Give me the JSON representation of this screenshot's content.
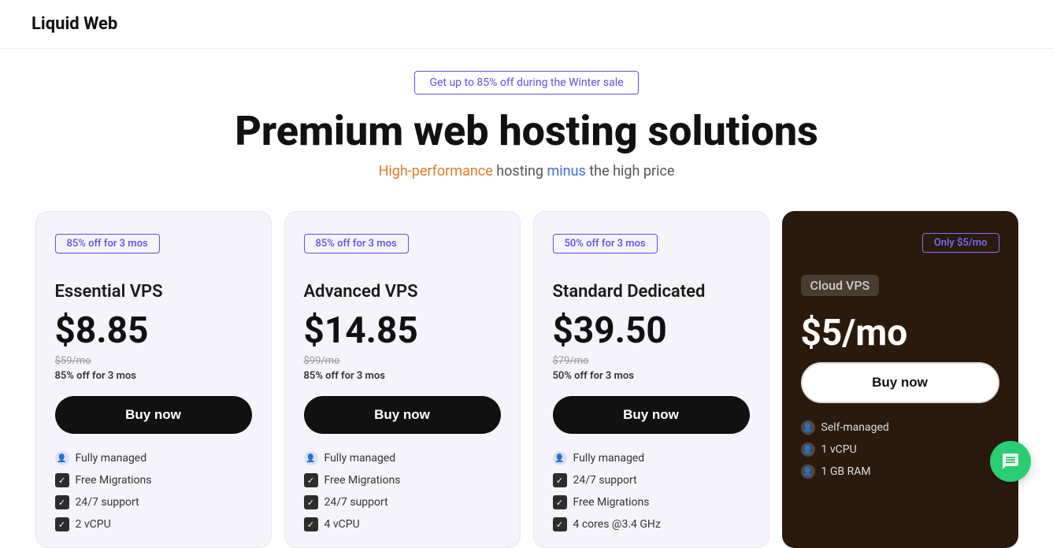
{
  "header": {
    "logo": "Liquid Web"
  },
  "promo": {
    "badge": "Get up to 85% off during the Winter sale"
  },
  "hero": {
    "title": "Premium web hosting solutions",
    "subtitle_part1": "High-performance",
    "subtitle_part2": " hosting ",
    "subtitle_part3": "minus",
    "subtitle_part4": " the high price"
  },
  "cards": [
    {
      "discount_badge": "85% off for 3 mos",
      "plan_name": "Essential VPS",
      "price_current": "$8.85",
      "price_original": "$59/mo",
      "price_discount_text": "85% off for 3 mos",
      "buy_label": "Buy now",
      "features": [
        {
          "icon": "user",
          "text": "Fully managed"
        },
        {
          "icon": "check",
          "text": "Free Migrations"
        },
        {
          "icon": "check",
          "text": "24/7 support"
        },
        {
          "icon": "check",
          "text": "2 vCPU"
        }
      ]
    },
    {
      "discount_badge": "85% off for 3 mos",
      "plan_name": "Advanced VPS",
      "price_current": "$14.85",
      "price_original": "$99/mo",
      "price_discount_text": "85% off for 3 mos",
      "buy_label": "Buy now",
      "features": [
        {
          "icon": "user",
          "text": "Fully managed"
        },
        {
          "icon": "check",
          "text": "Free Migrations"
        },
        {
          "icon": "check",
          "text": "24/7 support"
        },
        {
          "icon": "check",
          "text": "4 vCPU"
        }
      ]
    },
    {
      "discount_badge": "50% off for 3 mos",
      "plan_name": "Standard Dedicated",
      "price_current": "$39.50",
      "price_original": "$79/mo",
      "price_discount_text": "50% off for 3 mos",
      "buy_label": "Buy now",
      "features": [
        {
          "icon": "user",
          "text": "Fully managed"
        },
        {
          "icon": "check",
          "text": "24/7 support"
        },
        {
          "icon": "check",
          "text": "Free Migrations"
        },
        {
          "icon": "check",
          "text": "4 cores @3.4 GHz"
        }
      ]
    },
    {
      "discount_badge": "Only $5/mo",
      "plan_name_tag": "Cloud VPS",
      "price_current": "$5/mo",
      "buy_label": "Buy now",
      "features": [
        {
          "icon": "user",
          "text": "Self-managed"
        },
        {
          "icon": "user",
          "text": "1 vCPU"
        },
        {
          "icon": "user",
          "text": "1 GB RAM"
        }
      ]
    }
  ],
  "chat": {
    "label": "Chat"
  }
}
